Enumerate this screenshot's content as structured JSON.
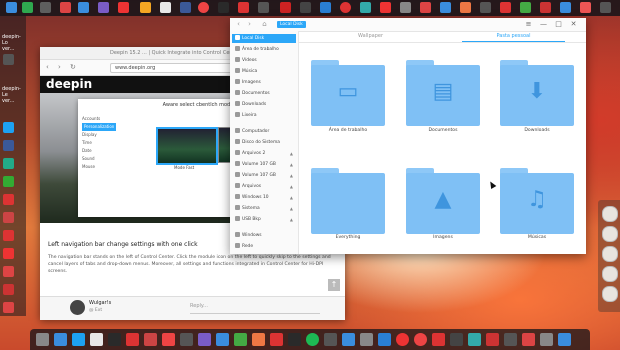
{
  "desktop": {
    "left_dock_labels": [
      "deepin-Lo",
      "ver...",
      "deepin-Le",
      "ver..."
    ]
  },
  "browser": {
    "title": "Deepin 15.2 ... | Quick Integrate into Control Center | Deepin Techn...",
    "url": "www.deepin.org",
    "logo": "deepin",
    "menu_icon": "≡",
    "modal": {
      "title": "Aware select cbentlch mode",
      "sidebar": [
        "Accounts",
        "Personalization",
        "Display",
        "Time",
        "Date",
        "Sound",
        "Mouse"
      ],
      "caption_left": "Mode Fast",
      "caption_right": "Mode Effect"
    },
    "heading": "Left navigation bar change settings with one click",
    "body": "The navigation bar stands on the left of Control Center. Click the module icon on the left to quickly skip to the settings and cancel layers of tabs and drop-down menus. Moreover, all settings and functions integrated in Control Center for Hi-DPI screens.",
    "back_to_top": "↑",
    "comment": {
      "name": "Wulgar!s",
      "sub": "@ Ext",
      "reply_placeholder": "Reply..."
    }
  },
  "file_manager": {
    "breadcrumb": "Local Disk",
    "window_controls": [
      "≡",
      "—",
      "□",
      "✕"
    ],
    "sidebar": [
      {
        "label": "Local Disk",
        "selected": true
      },
      {
        "label": "Área de trabalho",
        "selected": false
      },
      {
        "label": "Vídeos",
        "selected": false
      },
      {
        "label": "Música",
        "selected": false
      },
      {
        "label": "Imagens",
        "selected": false
      },
      {
        "label": "Documentos",
        "selected": false
      },
      {
        "label": "Downloads",
        "selected": false
      },
      {
        "label": "Lixeira",
        "selected": false
      },
      {
        "label": "Computador",
        "selected": false
      },
      {
        "label": "Disco do Sistema",
        "selected": false
      },
      {
        "label": "Arquivos 2",
        "selected": false,
        "eject": "▲"
      },
      {
        "label": "Volume 107 GB",
        "selected": false,
        "eject": "▲"
      },
      {
        "label": "Volume 107 GB",
        "selected": false,
        "eject": "▲"
      },
      {
        "label": "Arquivos",
        "selected": false,
        "eject": "▲"
      },
      {
        "label": "Windows 10",
        "selected": false,
        "eject": "▲"
      },
      {
        "label": "Sistema",
        "selected": false,
        "eject": "▲"
      },
      {
        "label": "USB Bkp",
        "selected": false,
        "eject": "▲"
      },
      {
        "label": "Windows",
        "selected": false
      },
      {
        "label": "Rede",
        "selected": false
      }
    ],
    "tabs": [
      {
        "label": "Wallpaper",
        "active": false
      },
      {
        "label": "Pasta pessoal",
        "active": true
      }
    ],
    "folders": [
      {
        "label": "Área de trabalho",
        "glyph": "▭"
      },
      {
        "label": "Documentos",
        "glyph": "▤"
      },
      {
        "label": "Downloads",
        "glyph": "⬇"
      },
      {
        "label": "Everything",
        "glyph": ""
      },
      {
        "label": "Imagens",
        "glyph": "▲"
      },
      {
        "label": "Músicas",
        "glyph": "♫"
      }
    ],
    "colors": {
      "accent": "#2ca7f8",
      "folder": "#7fc0f5"
    }
  }
}
